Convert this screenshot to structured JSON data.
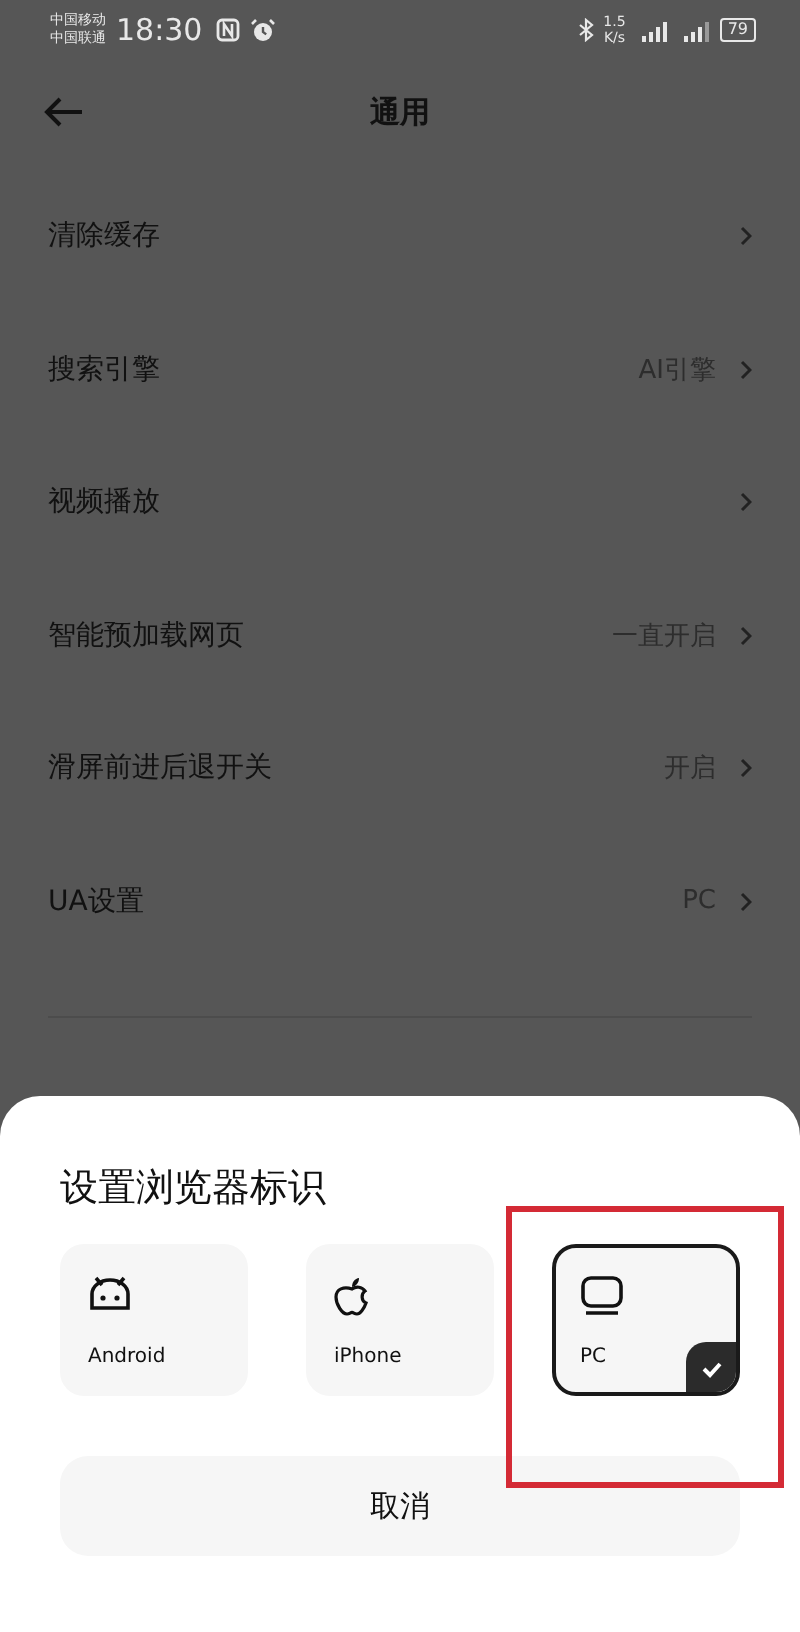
{
  "status_bar": {
    "carriers": [
      "中国移动",
      "中国联通"
    ],
    "time": "18:30",
    "speed_value": "1.5",
    "speed_unit": "K/s",
    "battery": "79"
  },
  "header": {
    "title": "通用"
  },
  "settings": [
    {
      "label": "清除缓存"
    },
    {
      "label": "搜索引擎",
      "value": "AI引擎"
    },
    {
      "label": "视频播放"
    },
    {
      "label": "智能预加载网页",
      "value": "一直开启"
    },
    {
      "label": "滑屏前进后退开关",
      "value": "开启"
    },
    {
      "label": "UA设置",
      "value": "PC"
    }
  ],
  "sheet": {
    "title": "设置浏览器标识",
    "options": [
      {
        "label": "Android",
        "kind": "android",
        "selected": false
      },
      {
        "label": "iPhone",
        "kind": "apple",
        "selected": false
      },
      {
        "label": "PC",
        "kind": "pc",
        "selected": true
      }
    ],
    "cancel": "取消"
  }
}
